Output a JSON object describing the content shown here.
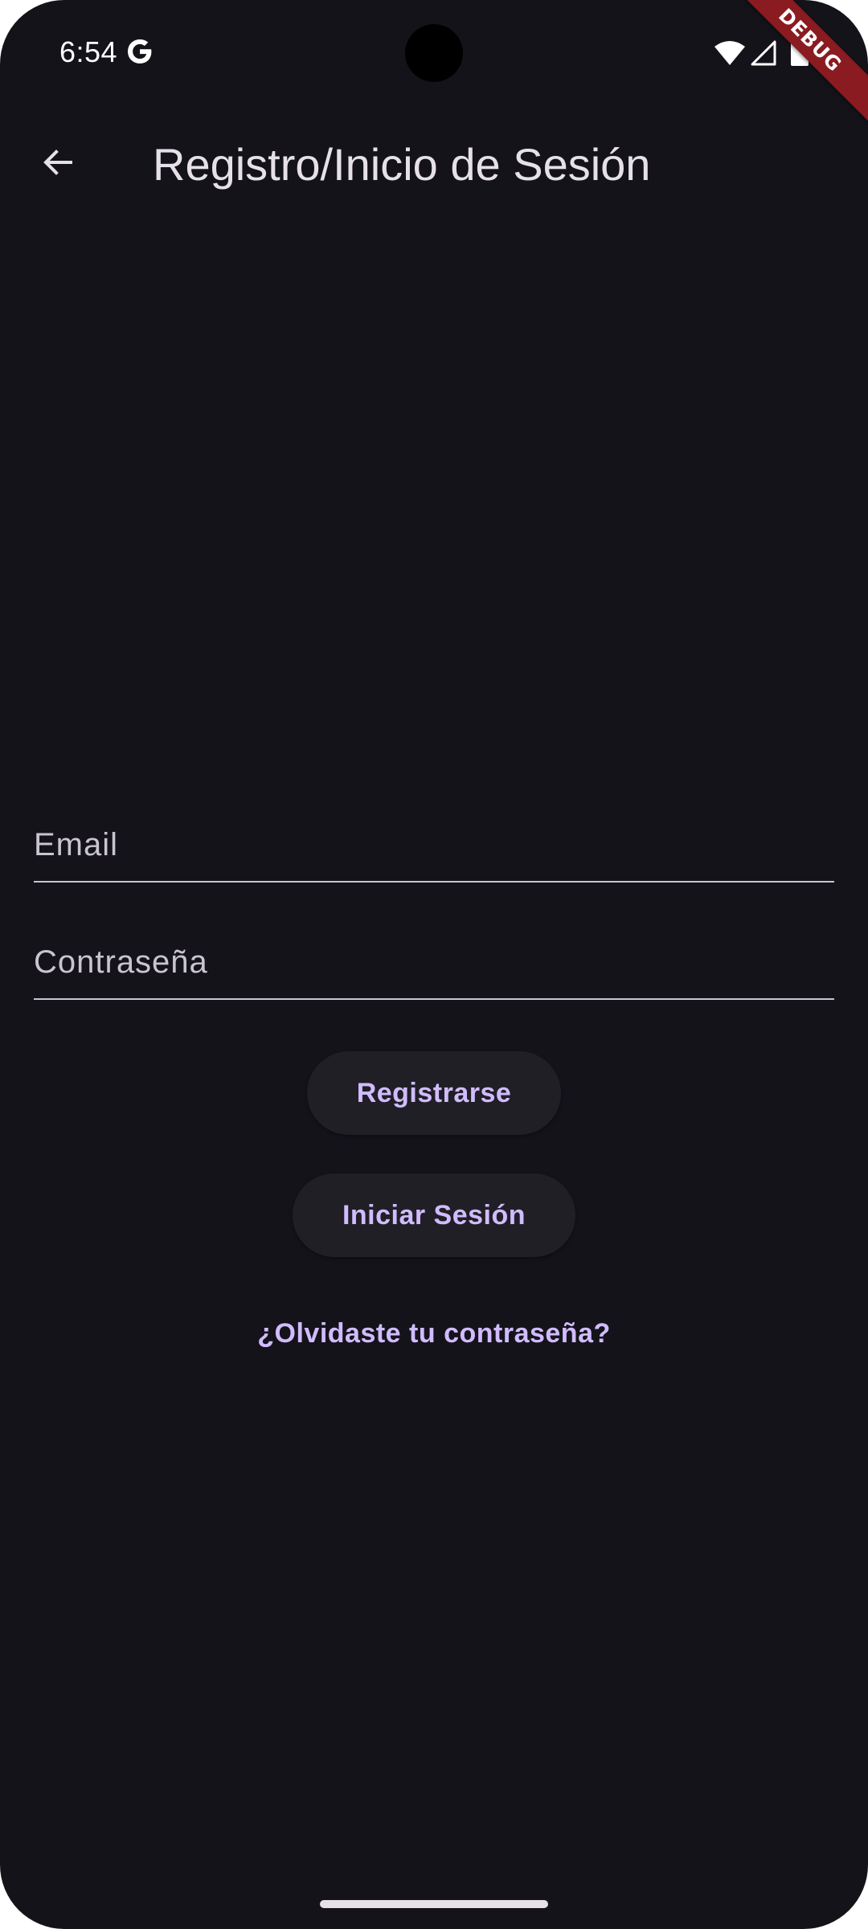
{
  "status_bar": {
    "time": "6:54",
    "icons": [
      "google-icon",
      "wifi-icon",
      "signal-icon",
      "battery-icon"
    ]
  },
  "debug_banner": {
    "label": "DEBUG",
    "color": "#8a1b21"
  },
  "app_bar": {
    "title": "Registro/Inicio de Sesión",
    "back_icon": "arrow-back-icon"
  },
  "form": {
    "email": {
      "placeholder": "Email",
      "value": ""
    },
    "password": {
      "placeholder": "Contraseña",
      "value": ""
    }
  },
  "actions": {
    "register_label": "Registrarse",
    "login_label": "Iniciar Sesión",
    "forgot_password_label": "¿Olvidaste tu contraseña?"
  },
  "theme": {
    "background": "#15131a",
    "accent": "#d0bcff",
    "button_surface": "#211f26"
  }
}
